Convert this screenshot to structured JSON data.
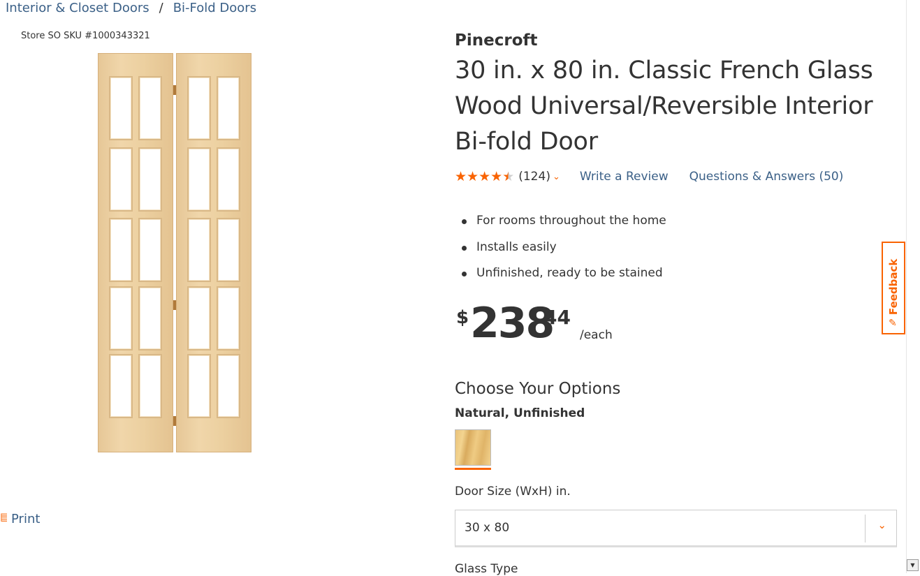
{
  "breadcrumb": {
    "items": [
      "Interior & Closet Doors",
      "Bi-Fold Doors"
    ],
    "separator": "/"
  },
  "sku": "Store SO SKU #1000343321",
  "print_label": "Print",
  "product": {
    "brand": "Pinecroft",
    "title": "30 in. x 80 in. Classic French Glass Wood Universal/Reversible Interior Bi-fold Door",
    "rating": 4.5,
    "rating_count": "(124)",
    "write_review": "Write a Review",
    "qa": "Questions & Answers (50)",
    "bullets": [
      "For rooms throughout the home",
      "Installs easily",
      "Unfinished, ready to be stained"
    ],
    "price": {
      "currency": "$",
      "whole": "238",
      "cents": "44",
      "unit": "/each"
    }
  },
  "options": {
    "heading": "Choose Your Options",
    "finish_name": "Natural, Unfinished",
    "size_label": "Door Size (WxH) in.",
    "size_value": "30 x 80",
    "glass_label": "Glass Type"
  },
  "feedback_label": "Feedback",
  "colors": {
    "accent": "#f96302",
    "link": "#3b6087"
  }
}
